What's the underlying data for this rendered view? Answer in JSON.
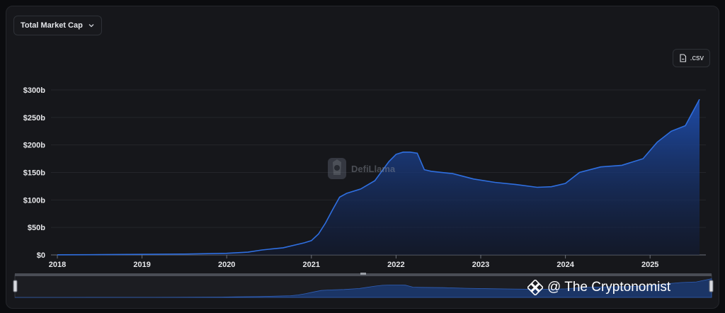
{
  "toolbar": {
    "metric_label": "Total Market Cap",
    "csv_label": ".csv"
  },
  "watermark": {
    "text": "DefiLlama"
  },
  "credit": {
    "text": "@ The Cryptonomist"
  },
  "colors": {
    "line": "#2f6fe0",
    "area_top": "#1f4fb0",
    "area_bottom": "#101a34",
    "brush_fill": "#1b3566"
  },
  "chart_data": {
    "type": "area",
    "title": "",
    "xlabel": "",
    "ylabel": "",
    "ylim": [
      0,
      300
    ],
    "yticks": [
      "$0",
      "$50b",
      "$100b",
      "$150b",
      "$200b",
      "$250b",
      "$300b"
    ],
    "xticks": [
      "2018",
      "2019",
      "2020",
      "2021",
      "2022",
      "2023",
      "2024",
      "2025"
    ],
    "grid": true,
    "legend": "none",
    "unit": "billion USD",
    "series": [
      {
        "x": [
          "2018-01",
          "2018-07",
          "2019-01",
          "2019-07",
          "2020-01",
          "2020-04",
          "2020-06",
          "2020-09",
          "2020-12",
          "2021-01",
          "2021-02",
          "2021-03",
          "2021-04",
          "2021-05",
          "2021-06",
          "2021-08",
          "2021-10",
          "2021-12",
          "2022-01",
          "2022-02",
          "2022-03",
          "2022-04",
          "2022-05",
          "2022-06",
          "2022-09",
          "2022-12",
          "2023-03",
          "2023-06",
          "2023-09",
          "2023-11",
          "2024-01",
          "2024-03",
          "2024-06",
          "2024-09",
          "2024-12",
          "2025-02",
          "2025-04",
          "2025-06",
          "2025-08"
        ],
        "values": [
          0.2,
          0.5,
          1,
          1.5,
          3,
          5,
          9,
          13,
          22,
          26,
          38,
          58,
          82,
          105,
          112,
          120,
          135,
          170,
          183,
          187,
          187,
          185,
          155,
          152,
          148,
          138,
          132,
          128,
          123,
          124,
          130,
          150,
          160,
          163,
          175,
          205,
          225,
          235,
          283
        ]
      }
    ]
  }
}
